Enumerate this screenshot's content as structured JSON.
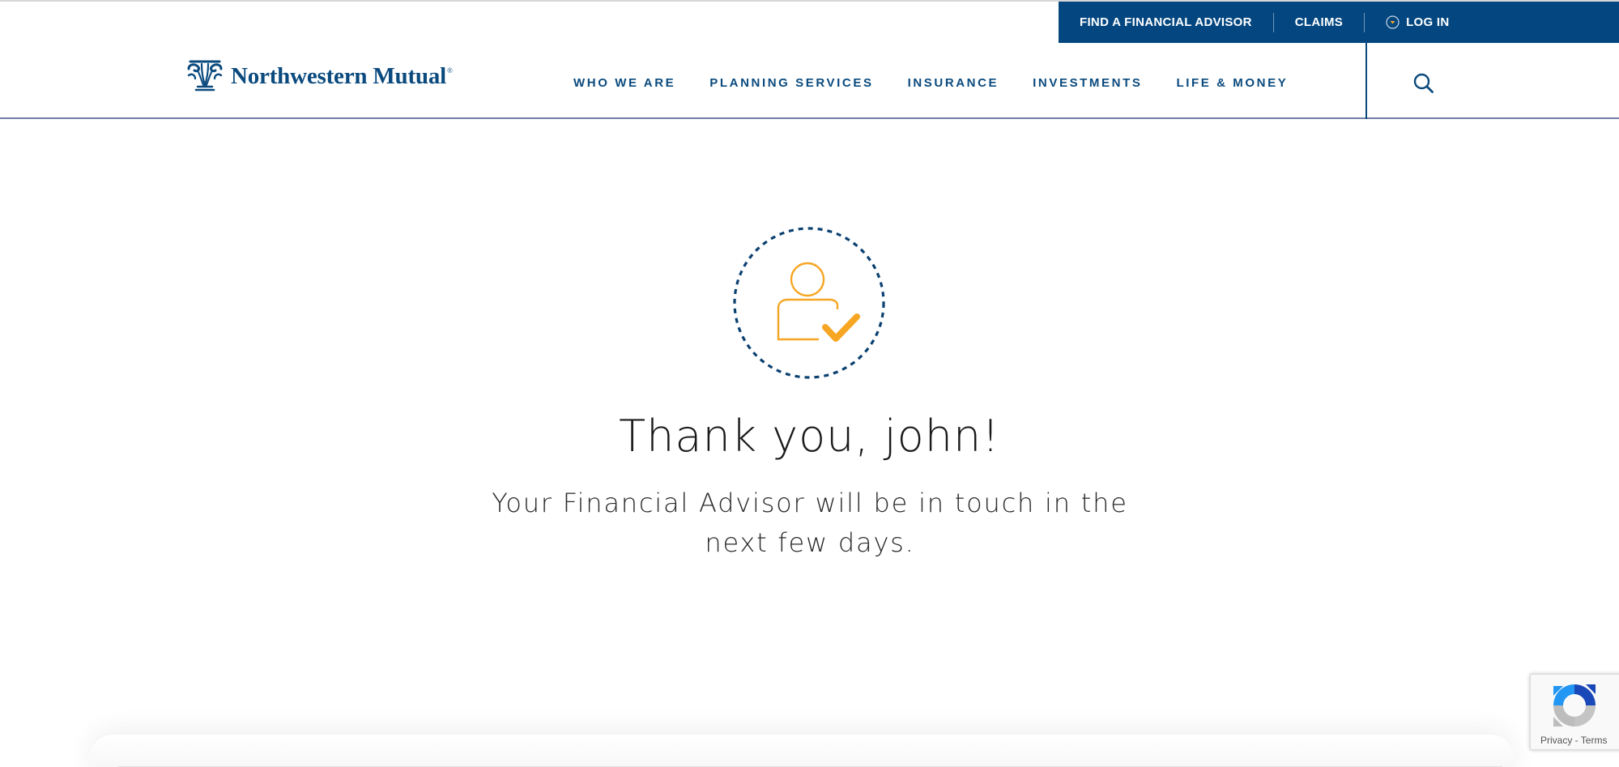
{
  "utility_bar": {
    "find_advisor": "FIND A FINANCIAL ADVISOR",
    "claims": "CLAIMS",
    "login": "LOG IN"
  },
  "header": {
    "logo_text": "Northwestern Mutual",
    "logo_reg": "®",
    "nav": [
      {
        "label": "WHO WE ARE"
      },
      {
        "label": "PLANNING SERVICES"
      },
      {
        "label": "INSURANCE"
      },
      {
        "label": "INVESTMENTS"
      },
      {
        "label": "LIFE & MONEY"
      }
    ],
    "search_icon": "search-icon"
  },
  "confirmation": {
    "icon": "person-check-icon",
    "title": "Thank you, john!",
    "message": "Your Financial Advisor will be in touch in the next few days."
  },
  "recaptcha": {
    "privacy": "Privacy",
    "separator": " - ",
    "terms": "Terms"
  },
  "colors": {
    "brand_blue": "#044780",
    "nav_text": "#0a4a7e",
    "accent_orange": "#f6a623"
  }
}
